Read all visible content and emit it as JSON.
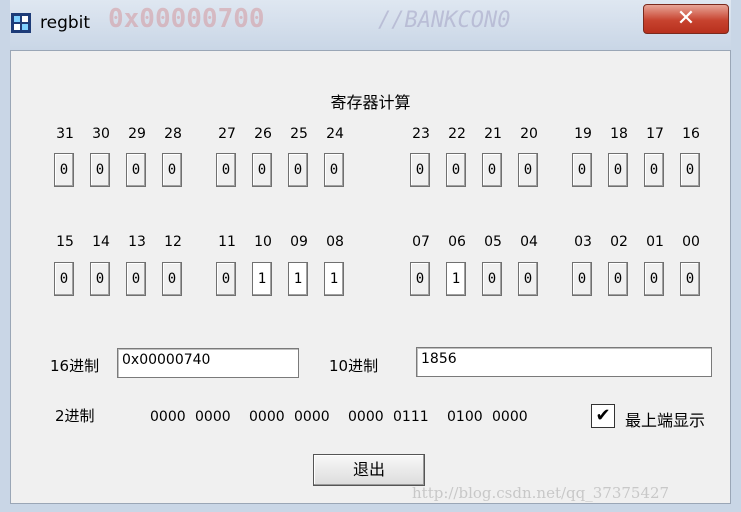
{
  "window": {
    "title": "regbit",
    "close_glyph": "✕",
    "background_code": [
      "0x00000700",
      "//BANKCON0"
    ]
  },
  "panel": {
    "heading": "寄存器计算"
  },
  "bits_top": [
    {
      "label": "31",
      "value": "0"
    },
    {
      "label": "30",
      "value": "0"
    },
    {
      "label": "29",
      "value": "0"
    },
    {
      "label": "28",
      "value": "0"
    },
    {
      "label": "27",
      "value": "0"
    },
    {
      "label": "26",
      "value": "0"
    },
    {
      "label": "25",
      "value": "0"
    },
    {
      "label": "24",
      "value": "0"
    },
    {
      "label": "23",
      "value": "0"
    },
    {
      "label": "22",
      "value": "0"
    },
    {
      "label": "21",
      "value": "0"
    },
    {
      "label": "20",
      "value": "0"
    },
    {
      "label": "19",
      "value": "0"
    },
    {
      "label": "18",
      "value": "0"
    },
    {
      "label": "17",
      "value": "0"
    },
    {
      "label": "16",
      "value": "0"
    }
  ],
  "bits_bottom": [
    {
      "label": "15",
      "value": "0"
    },
    {
      "label": "14",
      "value": "0"
    },
    {
      "label": "13",
      "value": "0"
    },
    {
      "label": "12",
      "value": "0"
    },
    {
      "label": "11",
      "value": "0"
    },
    {
      "label": "10",
      "value": "1"
    },
    {
      "label": "09",
      "value": "1"
    },
    {
      "label": "08",
      "value": "1"
    },
    {
      "label": "07",
      "value": "0"
    },
    {
      "label": "06",
      "value": "1"
    },
    {
      "label": "05",
      "value": "0"
    },
    {
      "label": "04",
      "value": "0"
    },
    {
      "label": "03",
      "value": "0"
    },
    {
      "label": "02",
      "value": "0"
    },
    {
      "label": "01",
      "value": "0"
    },
    {
      "label": "00",
      "value": "0"
    }
  ],
  "hex": {
    "label": "16进制",
    "value": "0x00000740"
  },
  "dec": {
    "label": "10进制",
    "value": "1856"
  },
  "bin": {
    "label": "2进制",
    "groups": [
      "0000",
      "0000",
      "0000",
      "0000",
      "0000",
      "0111",
      "0100",
      "0000"
    ]
  },
  "topmost": {
    "label": "最上端显示",
    "checked": true,
    "check_glyph": "✔"
  },
  "exit": {
    "label": "退出"
  },
  "watermark": "http://blog.csdn.net/qq_37375427"
}
